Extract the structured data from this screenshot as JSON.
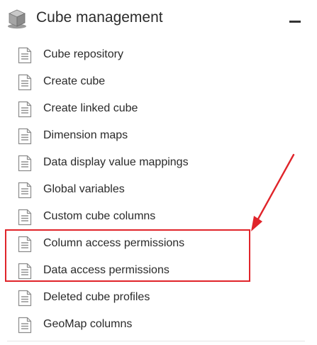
{
  "panel": {
    "title": "Cube management",
    "header_icon": "cube-database-icon",
    "collapse_icon": "minus-icon",
    "item_icon": "document-icon",
    "items": [
      {
        "label": "Cube repository"
      },
      {
        "label": "Create cube"
      },
      {
        "label": "Create linked cube"
      },
      {
        "label": "Dimension maps"
      },
      {
        "label": "Data display value mappings"
      },
      {
        "label": "Global variables"
      },
      {
        "label": "Custom cube columns"
      },
      {
        "label": "Column access permissions"
      },
      {
        "label": "Data access permissions"
      },
      {
        "label": "Deleted cube profiles"
      },
      {
        "label": "GeoMap columns"
      }
    ]
  },
  "annotation": {
    "color": "#e0242a",
    "highlighted_items": [
      "Column access permissions",
      "Data access permissions"
    ]
  }
}
